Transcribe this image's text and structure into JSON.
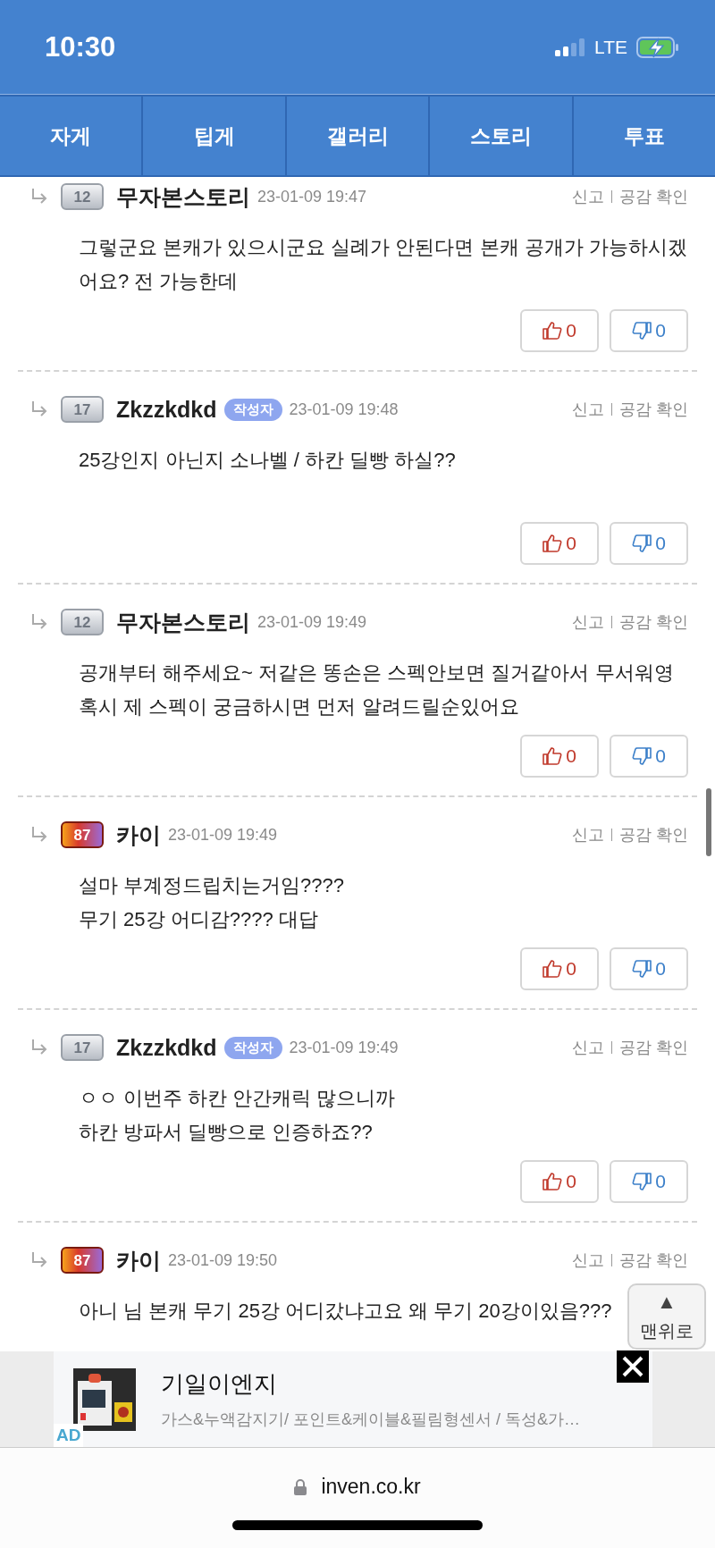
{
  "status_bar": {
    "time": "10:30",
    "network": "LTE"
  },
  "tabs": [
    {
      "label": "자게",
      "selected": false
    },
    {
      "label": "팁게",
      "selected": false
    },
    {
      "label": "갤러리",
      "selected": false
    },
    {
      "label": "스토리",
      "selected": false
    },
    {
      "label": "투표",
      "selected": false
    }
  ],
  "comments": [
    {
      "badge": "12",
      "kind": "silver",
      "author_name": "무자본스토리",
      "author": false,
      "date": "23-01-09 19:47",
      "report": "신고",
      "sympathy": "공감 확인",
      "text": [
        "그렇군요 본캐가 있으시군요 실례가 안된다면 본캐 공개가 가능하시겠어요? 전 가능한데"
      ],
      "likes": "0",
      "dislikes": "0"
    },
    {
      "badge": "17",
      "kind": "silver",
      "author_name": "Zkzzkdkd",
      "author": true,
      "author_tag": "작성자",
      "date": "23-01-09 19:48",
      "report": "신고",
      "sympathy": "공감 확인",
      "text": [
        "25강인지 아닌지 소나벨 / 하칸 딜빵 하실??"
      ],
      "likes": "0",
      "dislikes": "0"
    },
    {
      "badge": "12",
      "kind": "silver",
      "author_name": "무자본스토리",
      "author": false,
      "date": "23-01-09 19:49",
      "report": "신고",
      "sympathy": "공감 확인",
      "text": [
        "공개부터 해주세요~ 저같은 똥손은 스펙안보면 질거같아서 무서워영 혹시 제 스펙이 궁금하시면 먼저 알려드릴순있어요"
      ],
      "likes": "0",
      "dislikes": "0"
    },
    {
      "badge": "87",
      "kind": "red",
      "author_name": "카이",
      "author": false,
      "date": "23-01-09 19:49",
      "report": "신고",
      "sympathy": "공감 확인",
      "text": [
        "설마 부계정드립치는거임????",
        "무기 25강 어디감???? 대답"
      ],
      "likes": "0",
      "dislikes": "0"
    },
    {
      "badge": "17",
      "kind": "silver",
      "author_name": "Zkzzkdkd",
      "author": true,
      "author_tag": "작성자",
      "date": "23-01-09 19:49",
      "report": "신고",
      "sympathy": "공감 확인",
      "text": [
        "ㅇㅇ 이번주 하칸 안간캐릭 많으니까",
        "하칸 방파서 딜빵으로 인증하죠??"
      ],
      "likes": "0",
      "dislikes": "0"
    },
    {
      "badge": "87",
      "kind": "red",
      "author_name": "카이",
      "author": false,
      "date": "23-01-09 19:50",
      "report": "신고",
      "sympathy": "공감 확인",
      "text": [
        "아니 님 본캐 무기 25강 어디갔냐고요 왜 무기 20강이있음???"
      ]
    }
  ],
  "top_button": {
    "arrow": "▲",
    "label": "맨위로"
  },
  "ad": {
    "kind": "picture",
    "title": "기일이엔지",
    "description": "가스&누액감지기/ 포인트&케이블&필림형센서 / 독성&가…",
    "tag": "AD"
  },
  "address_bar": {
    "url": "inven.co.kr"
  }
}
